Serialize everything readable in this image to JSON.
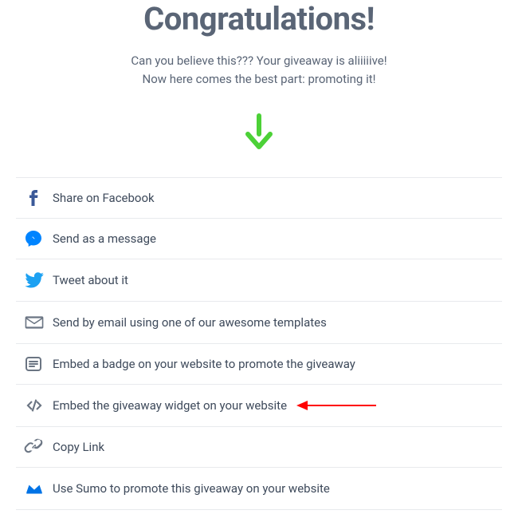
{
  "header": {
    "title": "Congratulations!",
    "subtitle_line1": "Can you believe this??? Your giveaway is aliiiiive!",
    "subtitle_line2": "Now here comes the best part: promoting it!"
  },
  "items": [
    {
      "icon": "facebook",
      "label": "Share on Facebook",
      "highlighted": false
    },
    {
      "icon": "messenger",
      "label": "Send as a message",
      "highlighted": false
    },
    {
      "icon": "twitter",
      "label": "Tweet about it",
      "highlighted": false
    },
    {
      "icon": "email",
      "label": "Send by email using one of our awesome templates",
      "highlighted": false
    },
    {
      "icon": "badge",
      "label": "Embed a badge on your website to promote the giveaway",
      "highlighted": false
    },
    {
      "icon": "code",
      "label": "Embed the giveaway widget on your website",
      "highlighted": true
    },
    {
      "icon": "link",
      "label": "Copy Link",
      "highlighted": false
    },
    {
      "icon": "sumo",
      "label": "Use Sumo to promote this giveaway on your website",
      "highlighted": false
    }
  ],
  "colors": {
    "facebook": "#3b5998",
    "messenger": "#0084ff",
    "twitter": "#1da1f2",
    "gray": "#6b7583",
    "sumo": "#0073e6",
    "arrow_green": "#4cd137",
    "pointer_red": "#ff0000"
  }
}
